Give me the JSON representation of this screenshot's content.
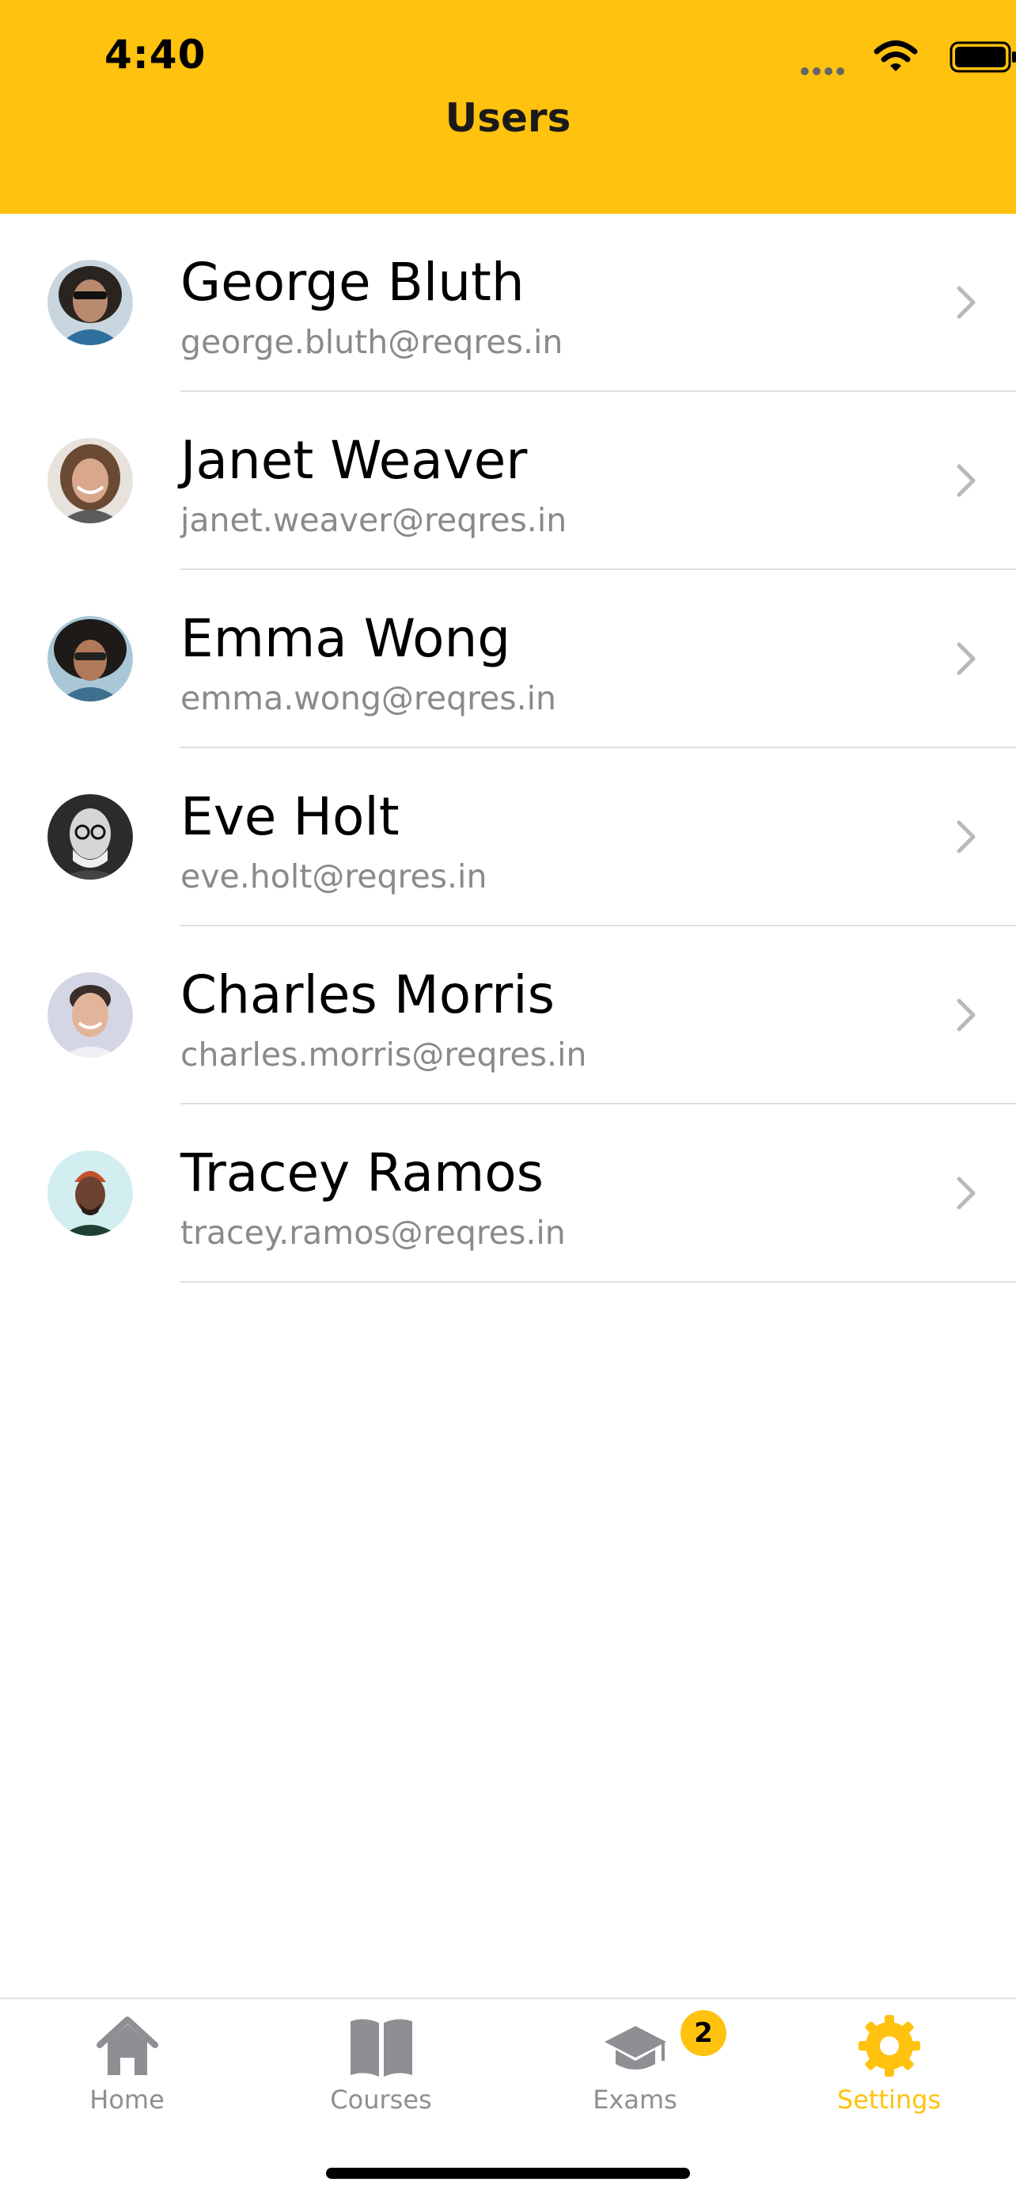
{
  "status_bar": {
    "time": "4:40"
  },
  "header": {
    "title": "Users"
  },
  "users": [
    {
      "name": "George Bluth",
      "email": "george.bluth@reqres.in"
    },
    {
      "name": "Janet Weaver",
      "email": "janet.weaver@reqres.in"
    },
    {
      "name": "Emma Wong",
      "email": "emma.wong@reqres.in"
    },
    {
      "name": "Eve Holt",
      "email": "eve.holt@reqres.in"
    },
    {
      "name": "Charles Morris",
      "email": "charles.morris@reqres.in"
    },
    {
      "name": "Tracey Ramos",
      "email": "tracey.ramos@reqres.in"
    }
  ],
  "tab_bar": {
    "tabs": [
      {
        "label": "Home",
        "icon": "home-icon"
      },
      {
        "label": "Courses",
        "icon": "book-icon"
      },
      {
        "label": "Exams",
        "icon": "graduation-cap-icon",
        "badge": "2"
      },
      {
        "label": "Settings",
        "icon": "gear-icon",
        "active": true
      }
    ]
  },
  "colors": {
    "accent": "#FFC20E",
    "inactive": "#8e8e93",
    "email_text": "#8a8a8a",
    "separator": "#dedede"
  }
}
